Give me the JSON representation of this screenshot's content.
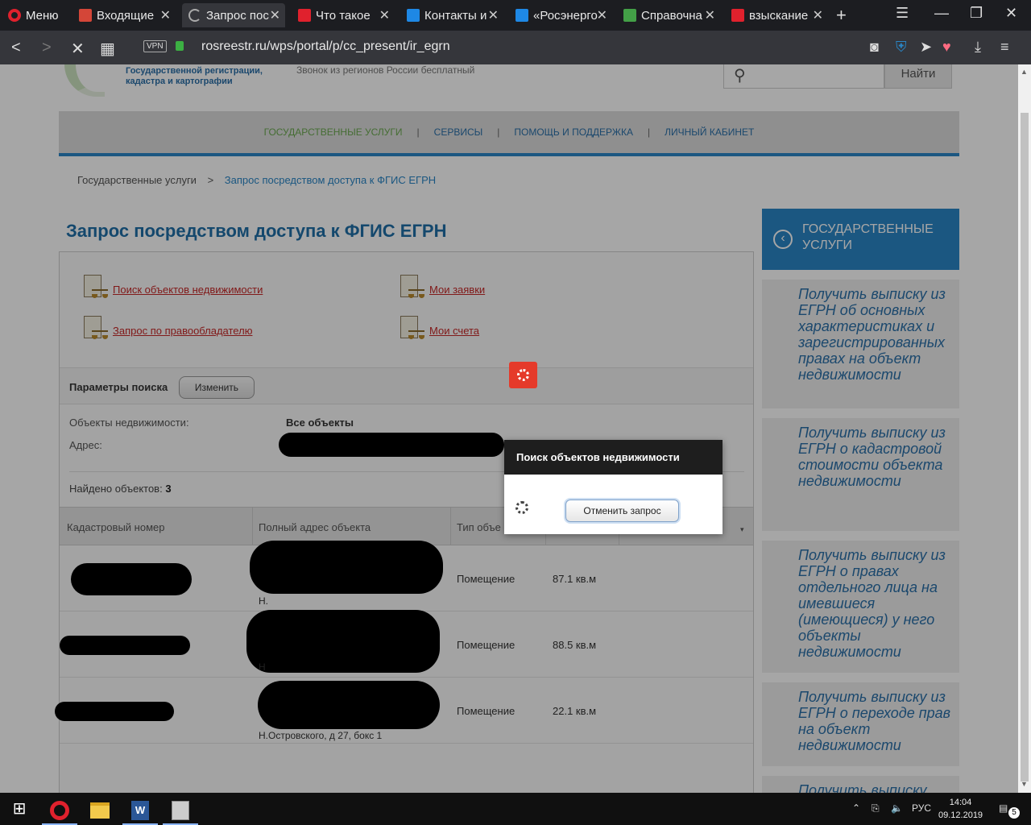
{
  "browser": {
    "menu_label": "Меню",
    "tabs": [
      {
        "label": "Входящие",
        "icon": "gmail-icon",
        "color": "#d44638"
      },
      {
        "label": "Запрос пос",
        "icon": "loading-icon",
        "color": "#aaaaaa"
      },
      {
        "label": "Что такое",
        "icon": "red-square-icon",
        "color": "#e0212d"
      },
      {
        "label": "Контакты и",
        "icon": "blue-square-icon",
        "color": "#1e88e5"
      },
      {
        "label": "«Росэнерго",
        "icon": "rosenergo-icon",
        "color": "#1e88e5"
      },
      {
        "label": "Справочна",
        "icon": "leaf-icon",
        "color": "#43a047"
      },
      {
        "label": "взыскание",
        "icon": "red-square-icon",
        "color": "#e0212d"
      }
    ],
    "url": "rosreestr.ru/wps/portal/p/cc_present/ir_egrn",
    "vpn_label": "VPN"
  },
  "header": {
    "logo_line1": "Государственной регистрации,",
    "logo_line2": "кадастра и картографии",
    "phone_note": "Звонок из регионов России бесплатный",
    "search_button": "Найти"
  },
  "topnav": {
    "items": [
      "ГОСУДАРСТВЕННЫЕ УСЛУГИ",
      "СЕРВИСЫ",
      "ПОМОЩЬ И ПОДДЕРЖКА",
      "ЛИЧНЫЙ КАБИНЕТ"
    ],
    "separator": "|"
  },
  "breadcrumb": {
    "root": "Государственные услуги",
    "sep": ">",
    "current": "Запрос посредством доступа к ФГИС ЕГРН"
  },
  "page_title": "Запрос посредством доступа к ФГИС ЕГРН",
  "links": [
    "Поиск объектов недвижимости",
    "Мои заявки",
    "Запрос по правообладателю",
    "Мои счета"
  ],
  "params": {
    "label": "Параметры поиска",
    "change_button": "Изменить",
    "objects_label": "Объекты недвижимости:",
    "objects_value": "Все объекты",
    "address_label": "Адрес:",
    "found_label": "Найдено объектов:",
    "found_count": "3"
  },
  "table": {
    "headers": [
      "Кадастровый номер",
      "Полный адрес объекта",
      "Тип объе"
    ],
    "rows": [
      {
        "addr_tail": "Н.",
        "type": "Помещение",
        "area": "87.1 кв.м"
      },
      {
        "addr_tail": "Н",
        "type": "Помещение",
        "area": "88.5 кв.м"
      },
      {
        "addr_tail": "Н.Островского, д 27, бокс 1",
        "type": "Помещение",
        "area": "22.1 кв.м"
      }
    ]
  },
  "sidebar": {
    "head": "ГОСУДАРСТВЕННЫЕ УСЛУГИ",
    "items": [
      "Получить выписку из ЕГРН об основных характеристиках и зарегистрированных правах на объект недвижимости",
      "Получить выписку из ЕГРН о кадастровой стоимости объекта недвижимости",
      "Получить выписку из ЕГРН о правах отдельного лица на имевшиеся (имеющиеся) у него объекты недвижимости",
      "Получить выписку из ЕГРН о переходе прав на объект недвижимости",
      "Получить выписку"
    ]
  },
  "dialog": {
    "title": "Поиск объектов недвижимости",
    "cancel_button": "Отменить запрос"
  },
  "taskbar": {
    "lang": "РУС",
    "time": "14:04",
    "date": "09.12.2019",
    "notifications": "5"
  }
}
